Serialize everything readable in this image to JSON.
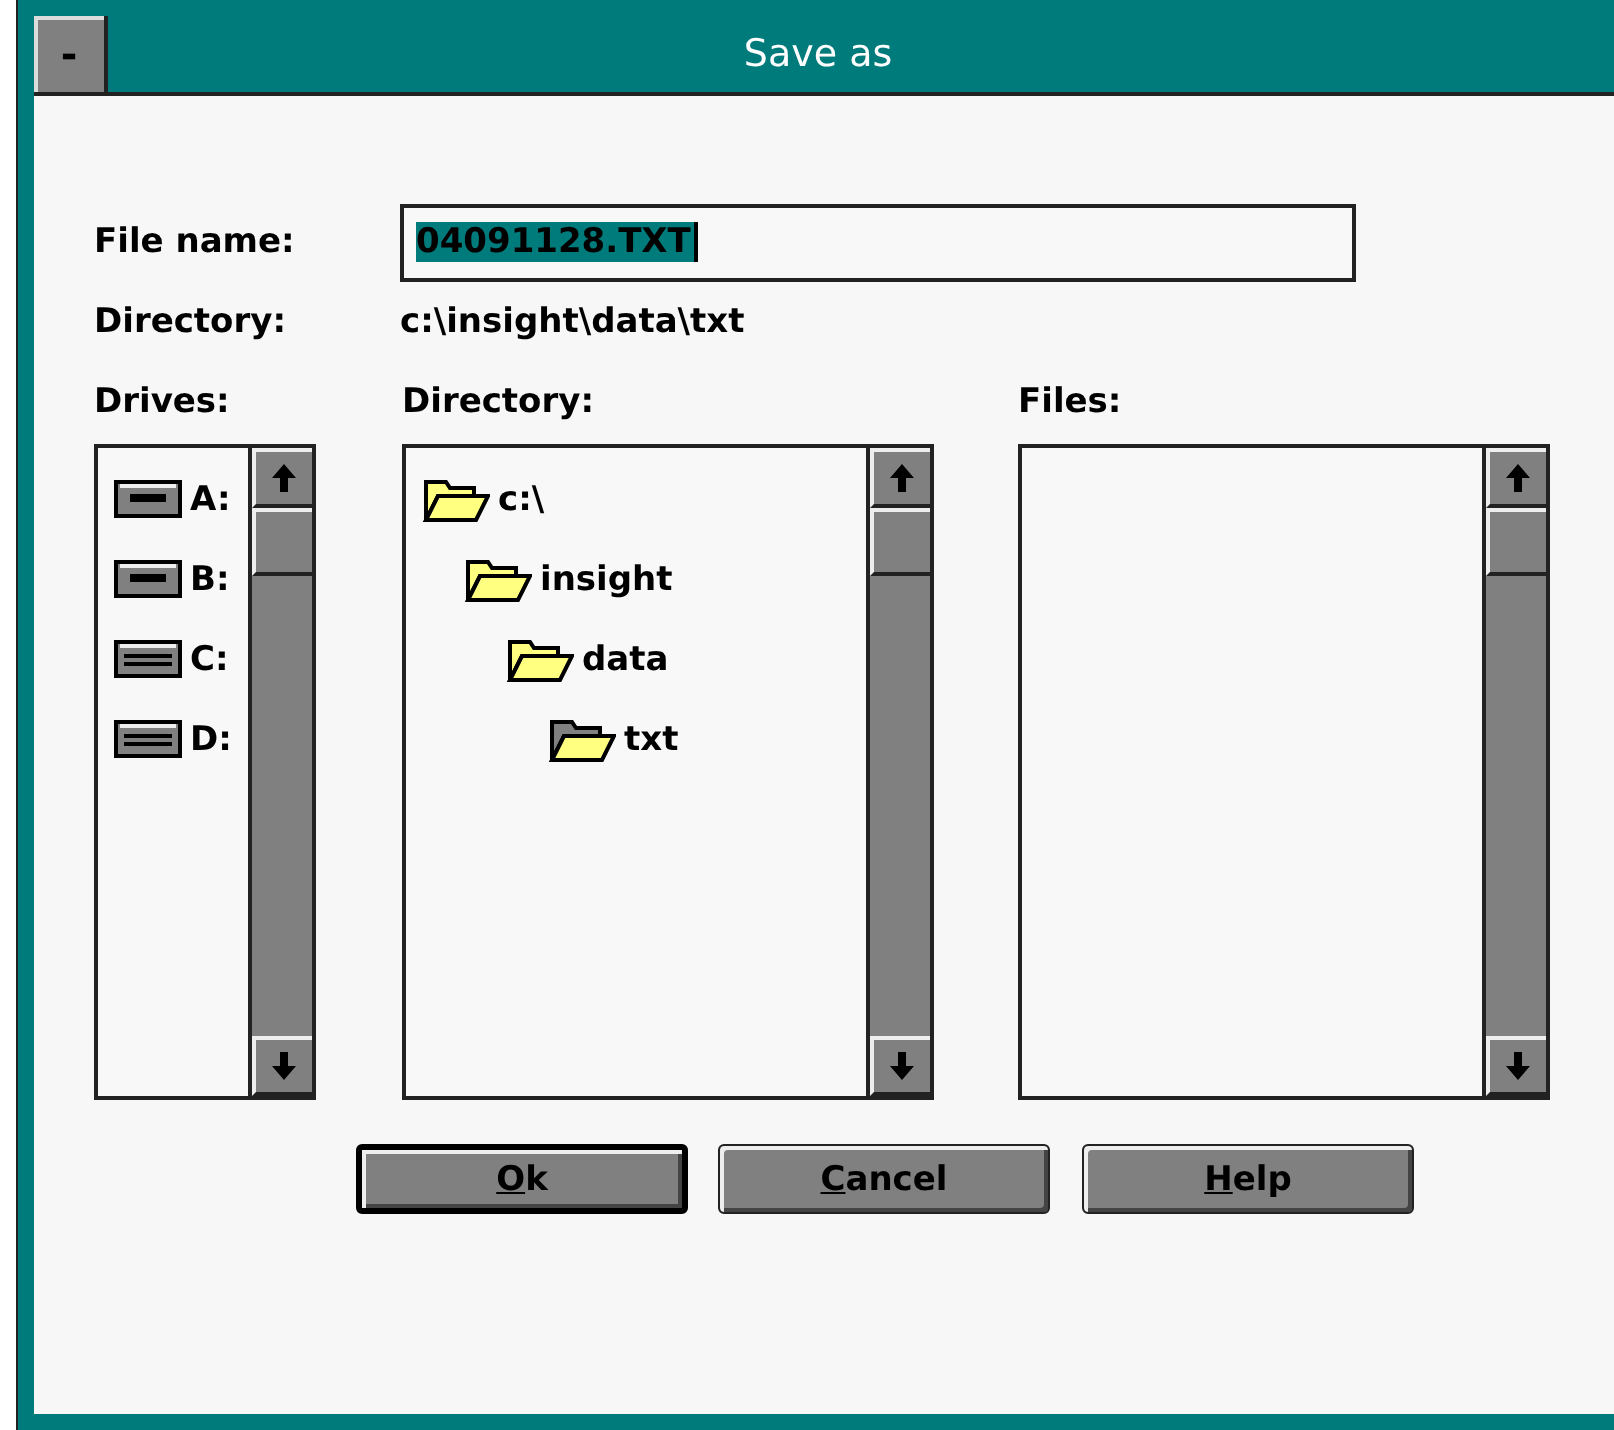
{
  "window": {
    "title": "Save as",
    "system_menu": "-"
  },
  "file_name": {
    "label": "File name:",
    "value": "04091128.TXT",
    "selected_text": true
  },
  "current_directory": {
    "label": "Directory:",
    "value": "c:\\insight\\data\\txt"
  },
  "drives": {
    "label": "Drives:",
    "items": [
      {
        "name": "A:",
        "kind": "floppy"
      },
      {
        "name": "B:",
        "kind": "floppy"
      },
      {
        "name": "C:",
        "kind": "hard"
      },
      {
        "name": "D:",
        "kind": "hard"
      }
    ]
  },
  "directory": {
    "label": "Directory:",
    "items": [
      {
        "name": "c:\\",
        "selected": false,
        "children": [
          {
            "name": "insight",
            "selected": false,
            "children": [
              {
                "name": "data",
                "selected": false,
                "children": [
                  {
                    "name": "txt",
                    "selected": true
                  }
                ]
              }
            ]
          }
        ]
      }
    ]
  },
  "files": {
    "label": "Files:"
  },
  "buttons": [
    {
      "label": "Ok",
      "default": true
    },
    {
      "label": "Cancel",
      "default": false
    },
    {
      "label": "Help",
      "default": false
    }
  ]
}
